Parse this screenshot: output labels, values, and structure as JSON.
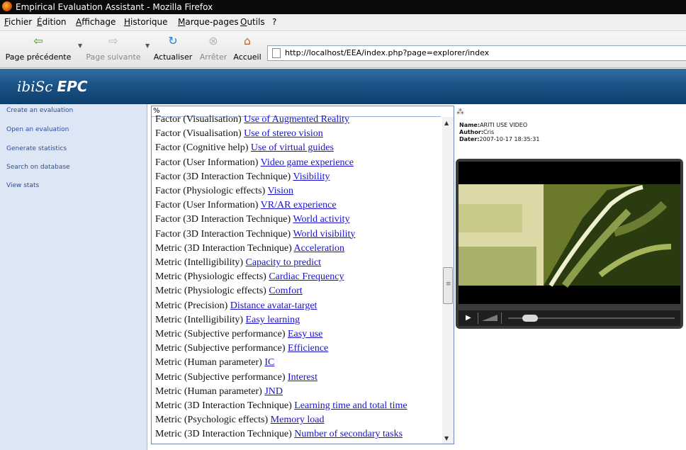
{
  "window": {
    "title": "Empirical Evaluation Assistant - Mozilla Firefox"
  },
  "menu": [
    "Fichier",
    "Édition",
    "Affichage",
    "Historique",
    "Marque-pages",
    "Outils",
    "?"
  ],
  "navigation": {
    "back": {
      "label": "Page précédente",
      "icon": "back-arrow-icon"
    },
    "forward": {
      "label": "Page suivante",
      "icon": "forward-arrow-icon"
    },
    "reload": {
      "label": "Actualiser",
      "icon": "reload-icon"
    },
    "stop": {
      "label": "Arrêter",
      "icon": "stop-icon"
    },
    "home": {
      "label": "Accueil",
      "icon": "home-icon"
    },
    "url": "http://localhost/EEA/index.php?page=explorer/index"
  },
  "brand": {
    "logo": "ibiSc",
    "product": "EPC"
  },
  "sidebar": [
    "Create an evaluation",
    "Open an evaluation",
    "Generate statistics",
    "Search on database",
    "View stats"
  ],
  "search": {
    "value": "%"
  },
  "results": [
    {
      "type": "Factor",
      "category": "(Visualisation)",
      "name": "Use of Augmented Reality"
    },
    {
      "type": "Factor",
      "category": "(Visualisation)",
      "name": "Use of stereo vision"
    },
    {
      "type": "Factor",
      "category": "(Cognitive help)",
      "name": "Use of virtual guides"
    },
    {
      "type": "Factor",
      "category": "(User Information)",
      "name": "Video game experience"
    },
    {
      "type": "Factor",
      "category": "(3D Interaction Technique)",
      "name": "Visibility"
    },
    {
      "type": "Factor",
      "category": "(Physiologic effects)",
      "name": "Vision"
    },
    {
      "type": "Factor",
      "category": "(User Information)",
      "name": "VR/AR experience"
    },
    {
      "type": "Factor",
      "category": "(3D Interaction Technique)",
      "name": "World activity"
    },
    {
      "type": "Factor",
      "category": "(3D Interaction Technique)",
      "name": "World visibility"
    },
    {
      "type": "Metric",
      "category": "(3D Interaction Technique)",
      "name": "Acceleration"
    },
    {
      "type": "Metric",
      "category": "(Intelligibility)",
      "name": "Capacity to predict"
    },
    {
      "type": "Metric",
      "category": "(Physiologic effects)",
      "name": "Cardiac Frequency"
    },
    {
      "type": "Metric",
      "category": "(Physiologic effects)",
      "name": "Comfort"
    },
    {
      "type": "Metric",
      "category": "(Precision)",
      "name": "Distance avatar-target"
    },
    {
      "type": "Metric",
      "category": "(Intelligibility)",
      "name": "Easy learning"
    },
    {
      "type": "Metric",
      "category": "(Subjective performance)",
      "name": "Easy use"
    },
    {
      "type": "Metric",
      "category": "(Subjective performance)",
      "name": "Efficience"
    },
    {
      "type": "Metric",
      "category": "(Human parameter)",
      "name": "IC"
    },
    {
      "type": "Metric",
      "category": "(Subjective performance)",
      "name": "Interest"
    },
    {
      "type": "Metric",
      "category": "(Human parameter)",
      "name": "JND"
    },
    {
      "type": "Metric",
      "category": "(3D Interaction Technique)",
      "name": "Learning time and total time"
    },
    {
      "type": "Metric",
      "category": "(Psychologic effects)",
      "name": "Memory load"
    },
    {
      "type": "Metric",
      "category": "(3D Interaction Technique)",
      "name": "Number of secondary tasks"
    }
  ],
  "detail": {
    "name_label": "Name:",
    "name": "ARITI USE VIDEO",
    "author_label": "Author:",
    "author": "Cris",
    "date_label": "Dater:",
    "date": "2007-10-17 18:35:31"
  },
  "video": {
    "progress": 0.03
  },
  "colors": {
    "banner": "#1b5487",
    "sidebar": "#dde6f5",
    "link": "#1a12c8"
  }
}
